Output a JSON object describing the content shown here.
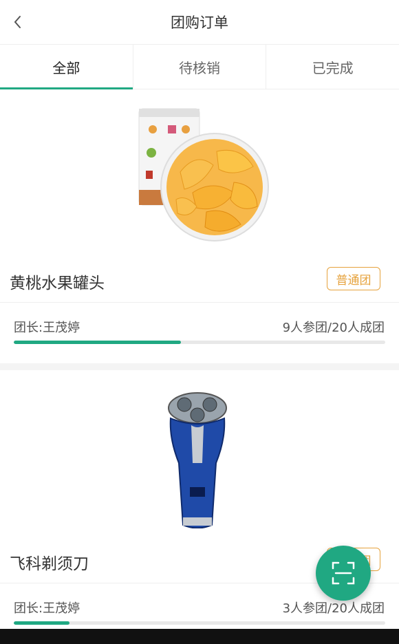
{
  "nav": {
    "title": "团购订单"
  },
  "tabs": [
    {
      "label": "全部",
      "active": true
    },
    {
      "label": "待核销",
      "active": false
    },
    {
      "label": "已完成",
      "active": false
    }
  ],
  "orders": [
    {
      "name": "黄桃水果罐头",
      "tag": "普通团",
      "leader": "团长:王茂婷",
      "progress_text": "9人参团/20人成团",
      "joined": 9,
      "target": 20,
      "image_icon": "canned-peach-image"
    },
    {
      "name": "飞科剃须刀",
      "tag": "普通团",
      "leader": "团长:王茂婷",
      "progress_text": "3人参团/20人成团",
      "joined": 3,
      "target": 20,
      "image_icon": "electric-shaver-image"
    }
  ],
  "colors": {
    "accent": "#20a882",
    "tag": "#e6a23c"
  },
  "fab": {
    "icon": "scan-icon"
  }
}
